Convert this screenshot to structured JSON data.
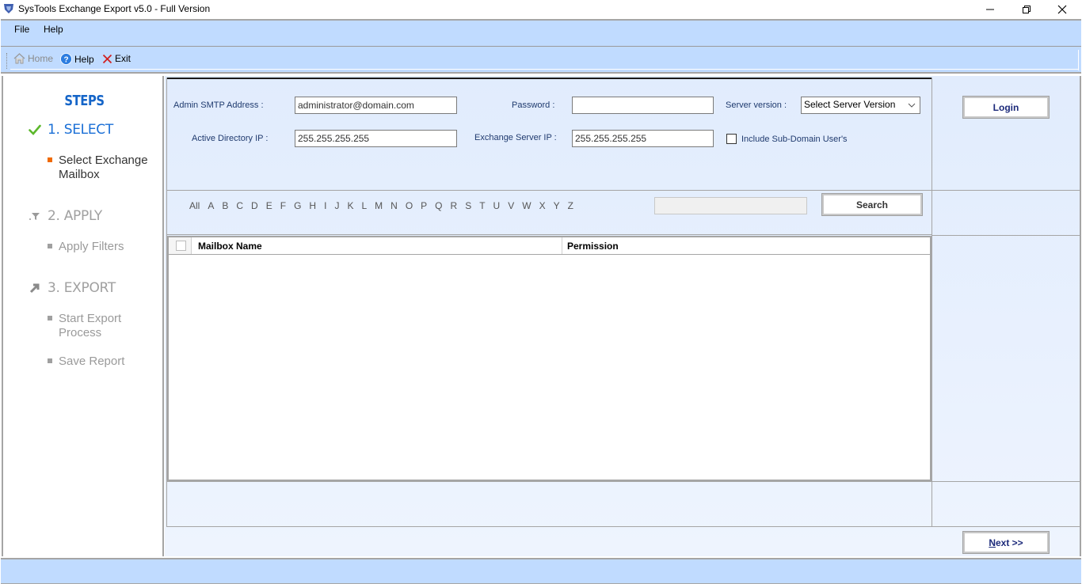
{
  "window": {
    "title": "SysTools Exchange Export v5.0 - Full Version",
    "controls": {
      "minimize": "—",
      "restore": "❐",
      "close": "✕"
    }
  },
  "menu": {
    "items": [
      {
        "label": "File"
      },
      {
        "label": "Help"
      }
    ]
  },
  "toolbar": {
    "home_label": "Home",
    "help_label": "Help",
    "exit_label": "Exit"
  },
  "sidebar": {
    "title": "STEPS",
    "steps": [
      {
        "label": "1. SELECT",
        "icon": "check-icon",
        "state": "active",
        "items": [
          {
            "label": "Select Exchange Mailbox",
            "state": "active"
          }
        ]
      },
      {
        "label": "2. APPLY",
        "icon": "filter-icon",
        "state": "inactive",
        "items": [
          {
            "label": "Apply Filters",
            "state": "inactive"
          }
        ]
      },
      {
        "label": "3. EXPORT",
        "icon": "export-arrow-icon",
        "state": "inactive",
        "items": [
          {
            "label": "Start Export Process",
            "state": "inactive"
          },
          {
            "label": "Save Report",
            "state": "inactive"
          }
        ]
      }
    ]
  },
  "form": {
    "admin_smtp_label": "Admin SMTP Address :",
    "admin_smtp_value": "administrator@domain.com",
    "password_label": "Password :",
    "password_value": "",
    "server_version_label": "Server version :",
    "server_version_selected": "Select Server Version",
    "active_directory_label": "Active Directory IP :",
    "active_directory_value": "255.255.255.255",
    "exchange_ip_label": "Exchange Server IP :",
    "exchange_ip_value": "255.255.255.255",
    "subdomain_label": "Include Sub-Domain User's",
    "subdomain_checked": false,
    "login_label": "Login"
  },
  "filter": {
    "letters": [
      "All",
      "A",
      "B",
      "C",
      "D",
      "E",
      "F",
      "G",
      "H",
      "I",
      "J",
      "K",
      "L",
      "M",
      "N",
      "O",
      "P",
      "Q",
      "R",
      "S",
      "T",
      "U",
      "V",
      "W",
      "X",
      "Y",
      "Z"
    ],
    "search_value": "",
    "search_label": "Search"
  },
  "grid": {
    "columns": [
      {
        "label": "Mailbox Name"
      },
      {
        "label": "Permission"
      }
    ],
    "rows": []
  },
  "footer": {
    "next_label_underlined": "N",
    "next_label_rest": "ext >>"
  },
  "colors": {
    "bar_blue": "#c0dbff",
    "steps_blue": "#1565c8",
    "active_bullet": "#f06a00",
    "check_green": "#5cb82c"
  }
}
